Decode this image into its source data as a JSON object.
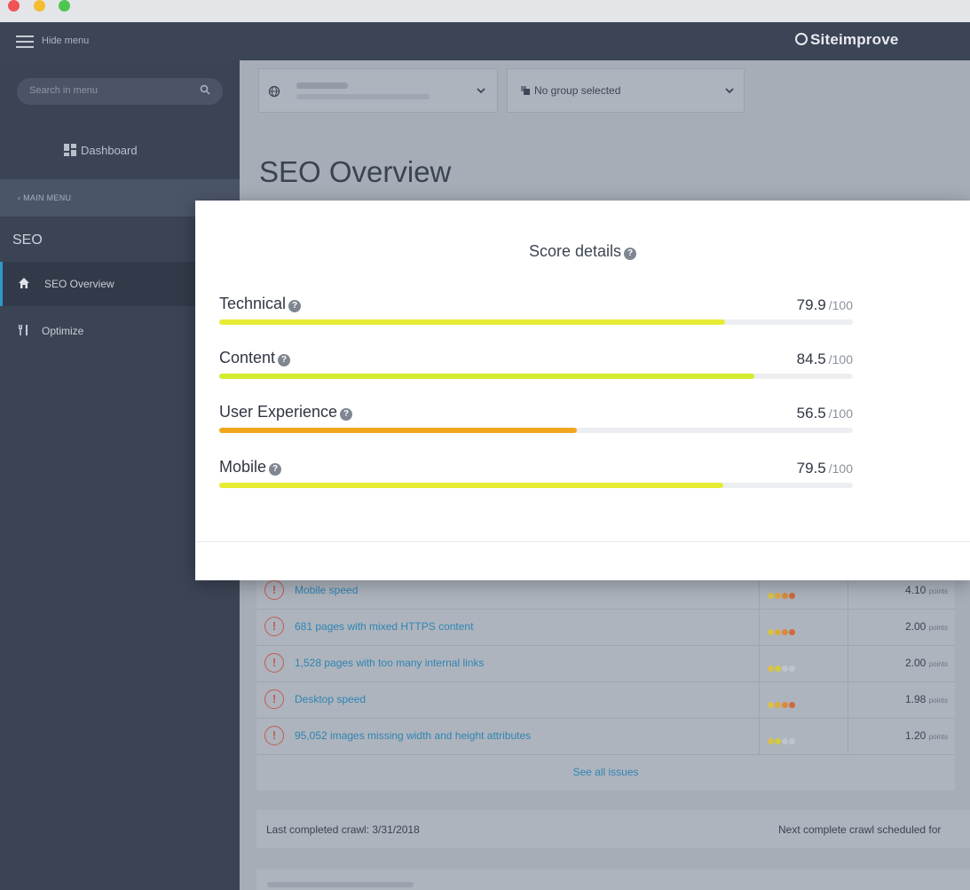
{
  "topbar": {
    "hide_menu": "Hide menu",
    "brand": "Siteimprove"
  },
  "sidebar": {
    "search_placeholder": "Search in menu",
    "dashboard": "Dashboard",
    "main_menu": "MAIN MENU",
    "section_title": "SEO",
    "items": [
      {
        "label": "SEO Overview",
        "icon": "home-icon",
        "active": true
      },
      {
        "label": "Optimize",
        "icon": "utensils-icon",
        "active": false
      }
    ]
  },
  "content": {
    "group_selector": "No group selected",
    "page_title": "SEO Overview"
  },
  "modal": {
    "title": "Score details",
    "max_label": "/100",
    "scores": [
      {
        "label": "Technical",
        "value": "79.9",
        "fraction": 0.799,
        "color": "#e6ec33"
      },
      {
        "label": "Content",
        "value": "84.5",
        "fraction": 0.845,
        "color": "#d3ec2d"
      },
      {
        "label": "User Experience",
        "value": "56.5",
        "fraction": 0.565,
        "color": "#f0a71f"
      },
      {
        "label": "Mobile",
        "value": "79.5",
        "fraction": 0.795,
        "color": "#e6ec33"
      }
    ]
  },
  "issues": {
    "rows": [
      {
        "text": "Mobile speed",
        "points": "4.10",
        "severity": 4
      },
      {
        "text": "681 pages with mixed HTTPS content",
        "points": "2.00",
        "severity": 4
      },
      {
        "text": "1,528 pages with too many internal links",
        "points": "2.00",
        "severity": 2
      },
      {
        "text": "Desktop speed",
        "points": "1.98",
        "severity": 4
      },
      {
        "text": "95,052 images missing width and height attributes",
        "points": "1.20",
        "severity": 2
      }
    ],
    "points_unit": "points",
    "see_all": "See all issues"
  },
  "crawl": {
    "last": "Last completed crawl: 3/31/2018",
    "next": "Next complete crawl scheduled for"
  },
  "colors": {
    "accent": "#2e98c9",
    "link": "#2e84b3",
    "alert": "#c35a54"
  }
}
